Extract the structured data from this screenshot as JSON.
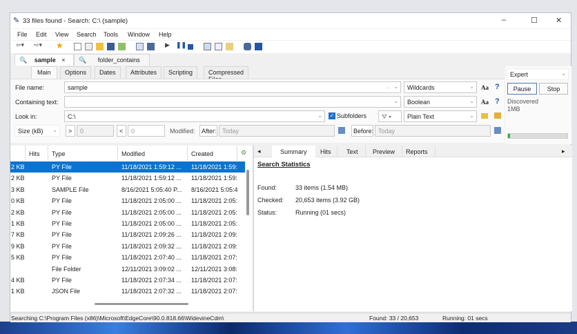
{
  "window": {
    "title": "33 files found - Search: C:\\ (sample)",
    "minimize": "–",
    "maximize": "☐",
    "close": "✕"
  },
  "menu": [
    "File",
    "Edit",
    "View",
    "Search",
    "Tools",
    "Window",
    "Help"
  ],
  "search_tabs": [
    {
      "label": "sample",
      "close": "×"
    },
    {
      "label": "folder_contains"
    }
  ],
  "sub_tabs": [
    "Main",
    "Options",
    "Dates",
    "Attributes",
    "Scripting",
    "Compressed Files"
  ],
  "form": {
    "file_name_label": "File name:",
    "file_name_value": "sample",
    "file_name_mode": "Wildcards",
    "containing_label": "Containing text:",
    "containing_value": "",
    "containing_mode": "Boolean",
    "look_in_label": "Look in:",
    "look_in_value": "C:\\",
    "subfolders_label": "Subfolders",
    "subfolders_checked": true,
    "text_mode": "Plain Text",
    "size_label": "Size (kB)",
    "gt": ">",
    "gt_value": "0",
    "lt": "<",
    "lt_value": "0",
    "modified_label": "Modified:",
    "after_label": "After:",
    "after_value": "Today",
    "before_label": "Before:",
    "before_value": "Today",
    "case_label": "Aa",
    "help": "?",
    "ellipsis": "..."
  },
  "right_panel": {
    "mode": "Expert",
    "pause": "Pause",
    "stop": "Stop",
    "discovered": "Discovered",
    "discovered_size": "1MB",
    "progress": 0.03
  },
  "list": {
    "columns": [
      "Hits",
      "Type",
      "Modified",
      "Created"
    ],
    "rows": [
      {
        "size": "2 KB",
        "type": "PY File",
        "modified": "11/18/2021 1:59:12 ...",
        "created": "11/18/2021 1:59:",
        "selected": true
      },
      {
        "size": "2 KB",
        "type": "PY File",
        "modified": "11/18/2021 1:59:12 ...",
        "created": "11/18/2021 1:59:"
      },
      {
        "size": "3 KB",
        "type": "SAMPLE File",
        "modified": "8/16/2021 5:05:40 P...",
        "created": "8/16/2021 5:05:4"
      },
      {
        "size": "0 KB",
        "type": "PY File",
        "modified": "11/18/2021 2:05:00 ...",
        "created": "11/18/2021 2:05:"
      },
      {
        "size": "2 KB",
        "type": "PY File",
        "modified": "11/18/2021 2:05:00 ...",
        "created": "11/18/2021 2:05:"
      },
      {
        "size": "1 KB",
        "type": "PY File",
        "modified": "11/18/2021 2:05:00 ...",
        "created": "11/18/2021 2:05:"
      },
      {
        "size": "7 KB",
        "type": "PY File",
        "modified": "11/18/2021 2:09:26 ...",
        "created": "11/18/2021 2:09:"
      },
      {
        "size": "9 KB",
        "type": "PY File",
        "modified": "11/18/2021 2:09:32 ...",
        "created": "11/18/2021 2:09:"
      },
      {
        "size": "5 KB",
        "type": "PY File",
        "modified": "11/18/2021 2:07:40 ...",
        "created": "11/18/2021 2:07:"
      },
      {
        "size": "",
        "type": "File Folder",
        "modified": "12/11/2021 3:09:02 ...",
        "created": "12/11/2021 3:08:"
      },
      {
        "size": "4 KB",
        "type": "PY File",
        "modified": "11/18/2021 2:07:34 ...",
        "created": "11/18/2021 2:07:"
      },
      {
        "size": "1 KB",
        "type": "JSON File",
        "modified": "11/18/2021 2:07:32 ...",
        "created": "11/18/2021 2:07:"
      }
    ]
  },
  "pane": {
    "tabs": [
      "Summary",
      "Hits",
      "Text",
      "Preview",
      "Reports"
    ],
    "left_arrow": "◂",
    "right_arrow": "▸",
    "heading": "Search Statistics",
    "stats": [
      {
        "label": "Found:",
        "value": "33 items (1.54 MB)"
      },
      {
        "label": "Checked:",
        "value": "20,653 items (3.92 GB)"
      },
      {
        "label": "Status:",
        "value": "Running (01 secs)"
      }
    ]
  },
  "status": {
    "path": "Searching C:\\Program Files (x86)\\Microsoft\\EdgeCore\\90.0.818.66\\WidevineCdm\\",
    "found": "Found: 33 / 20,653",
    "running": "Running: 01 secs"
  },
  "colors": {
    "selection": "#0a74d0",
    "progress": "#22b14c"
  }
}
